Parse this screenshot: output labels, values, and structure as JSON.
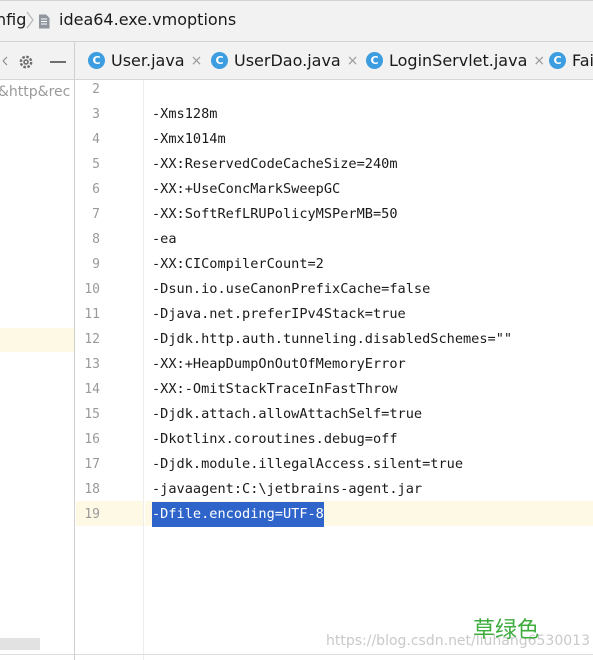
{
  "breadcrumb": {
    "parent": "nfig",
    "file": "idea64.exe.vmoptions"
  },
  "project_panel": {
    "truncated_path": "&http&rec"
  },
  "tabs": [
    {
      "icon": "C",
      "label": "User.java",
      "close": "×"
    },
    {
      "icon": "C",
      "label": "UserDao.java",
      "close": "×"
    },
    {
      "icon": "C",
      "label": "LoginServlet.java",
      "close": "×"
    },
    {
      "icon": "C",
      "label": "Fai",
      "close": ""
    }
  ],
  "editor": {
    "lines": [
      {
        "num": "2",
        "text": ""
      },
      {
        "num": "3",
        "text": "-Xms128m"
      },
      {
        "num": "4",
        "text": "-Xmx1014m"
      },
      {
        "num": "5",
        "text": "-XX:ReservedCodeCacheSize=240m"
      },
      {
        "num": "6",
        "text": "-XX:+UseConcMarkSweepGC"
      },
      {
        "num": "7",
        "text": "-XX:SoftRefLRUPolicyMSPerMB=50"
      },
      {
        "num": "8",
        "text": "-ea"
      },
      {
        "num": "9",
        "text": "-XX:CICompilerCount=2"
      },
      {
        "num": "10",
        "text": "-Dsun.io.useCanonPrefixCache=false"
      },
      {
        "num": "11",
        "text": "-Djava.net.preferIPv4Stack=true"
      },
      {
        "num": "12",
        "text": "-Djdk.http.auth.tunneling.disabledSchemes=\"\""
      },
      {
        "num": "13",
        "text": "-XX:+HeapDumpOnOutOfMemoryError"
      },
      {
        "num": "14",
        "text": "-XX:-OmitStackTraceInFastThrow"
      },
      {
        "num": "15",
        "text": "-Djdk.attach.allowAttachSelf=true"
      },
      {
        "num": "16",
        "text": "-Dkotlinx.coroutines.debug=off"
      },
      {
        "num": "17",
        "text": "-Djdk.module.illegalAccess.silent=true"
      },
      {
        "num": "18",
        "text": "-javaagent:C:\\jetbrains-agent.jar"
      },
      {
        "num": "19",
        "text": "-Dfile.encoding=UTF-8"
      }
    ]
  },
  "watermark": {
    "cn": "草绿色",
    "url": "https://blog.csdn.net/liuhang6530013"
  },
  "colors": {
    "selection": "#2f65ca",
    "current_line": "#fdf9e4",
    "class_icon": "#3c9de0"
  }
}
